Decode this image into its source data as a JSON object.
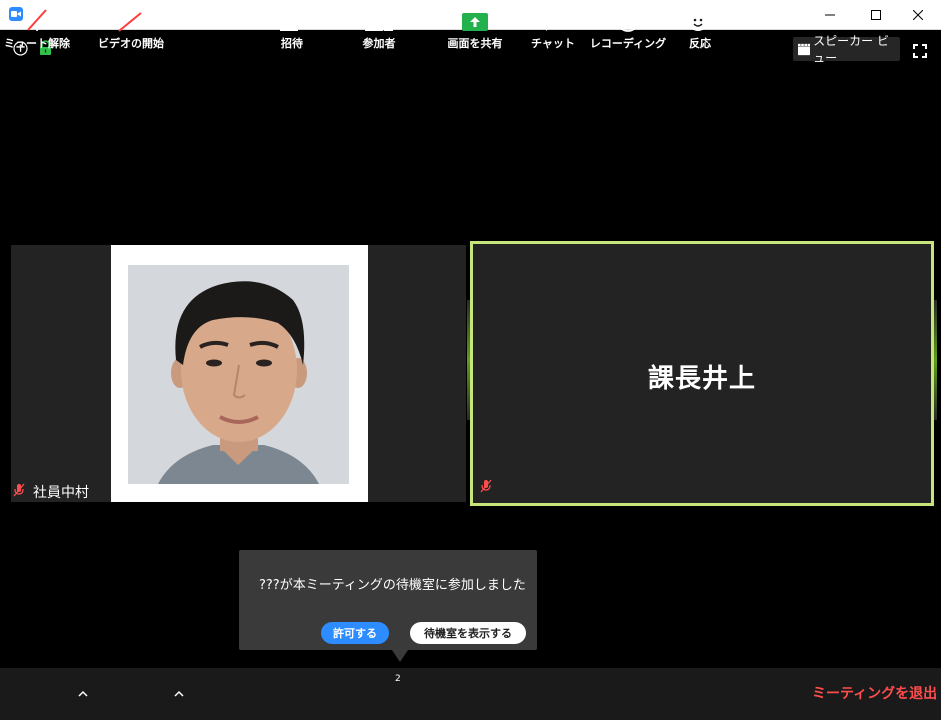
{
  "window": {
    "minimize_icon": "minimize-icon",
    "maximize_icon": "maximize-icon",
    "close_icon": "close-icon"
  },
  "top_bar": {
    "speaker_view_label": "スピーカー ビュー"
  },
  "participants": {
    "left_name": "社員中村",
    "right_name": "課長井上"
  },
  "notification": {
    "message": "???が本ミーティングの待機室に参加しました",
    "admit_label": "許可する",
    "view_waiting_room_label": "待機室を表示する"
  },
  "toolbar": {
    "unmute_label": "ミュート解除",
    "start_video_label": "ビデオの開始",
    "invite_label": "招待",
    "participants_label": "参加者",
    "participants_count": "2",
    "share_screen_label": "画面を共有",
    "chat_label": "チャット",
    "recording_label": "レコーディング",
    "reactions_label": "反応",
    "leave_label": "ミーティングを退出"
  },
  "colors": {
    "accent_blue": "#2d8cff",
    "active_speaker_border": "#c6e57a",
    "leave_red": "#ff4d4d",
    "share_green": "#23b14d"
  }
}
